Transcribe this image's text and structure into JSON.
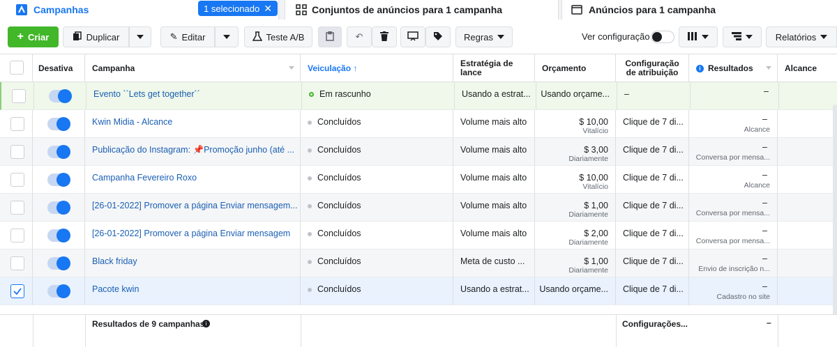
{
  "tabs": {
    "campaigns": "Campanhas",
    "selected_pill": "1 selecionado",
    "adsets": "Conjuntos de anúncios para 1 campanha",
    "ads": "Anúncios para 1 campanha"
  },
  "toolbar": {
    "create": "Criar",
    "duplicate": "Duplicar",
    "edit": "Editar",
    "ab_test": "Teste A/B",
    "rules": "Regras",
    "see_config": "Ver configuração",
    "reports": "Relatórios"
  },
  "columns": {
    "deactivate": "Desativa",
    "campaign": "Campanha",
    "delivery": "Veiculação ↑",
    "strategy_line1": "Estratégia de",
    "strategy_line2": "lance",
    "budget": "Orçamento",
    "attribution_line1": "Configuração",
    "attribution_line2": "de atribuição",
    "results": "Resultados",
    "reach": "Alcance"
  },
  "rows": [
    {
      "name": "Evento ``Lets get together´´",
      "delivery": "Em rascunho",
      "strategy": "Usando a estrat...",
      "budget": "Usando orçame...",
      "budget_sub": "",
      "attribution": "–",
      "result": "–",
      "result_sub": "",
      "checked": false
    },
    {
      "name": "Kwin Midia - Alcance",
      "delivery": "Concluídos",
      "strategy": "Volume mais alto",
      "budget": "$ 10,00",
      "budget_sub": "Vitalício",
      "attribution": "Clique de 7 di...",
      "result": "–",
      "result_sub": "Alcance",
      "checked": false
    },
    {
      "name": "Publicação do Instagram: 📌Promoção junho (até ...",
      "delivery": "Concluídos",
      "strategy": "Volume mais alto",
      "budget": "$ 3,00",
      "budget_sub": "Diariamente",
      "attribution": "Clique de 7 di...",
      "result": "–",
      "result_sub": "Conversa por mensa...",
      "checked": false
    },
    {
      "name": "Campanha Fevereiro Roxo",
      "delivery": "Concluídos",
      "strategy": "Volume mais alto",
      "budget": "$ 10,00",
      "budget_sub": "Vitalício",
      "attribution": "Clique de 7 di...",
      "result": "–",
      "result_sub": "Alcance",
      "checked": false
    },
    {
      "name": "[26-01-2022] Promover a página Enviar mensagem...",
      "delivery": "Concluídos",
      "strategy": "Volume mais alto",
      "budget": "$ 1,00",
      "budget_sub": "Diariamente",
      "attribution": "Clique de 7 di...",
      "result": "–",
      "result_sub": "Conversa por mensa...",
      "checked": false
    },
    {
      "name": "[26-01-2022] Promover a página Enviar mensagem",
      "delivery": "Concluídos",
      "strategy": "Volume mais alto",
      "budget": "$ 2,00",
      "budget_sub": "Diariamente",
      "attribution": "Clique de 7 di...",
      "result": "–",
      "result_sub": "Conversa por mensa...",
      "checked": false
    },
    {
      "name": "Black friday",
      "delivery": "Concluídos",
      "strategy": "Meta de custo ...",
      "budget": "$ 1,00",
      "budget_sub": "Diariamente",
      "attribution": "Clique de 7 di...",
      "result": "–",
      "result_sub": "Envio de inscrição n...",
      "checked": false
    },
    {
      "name": "Pacote kwin",
      "delivery": "Concluídos",
      "strategy": "Usando a estrat...",
      "budget": "Usando orçame...",
      "budget_sub": "",
      "attribution": "Clique de 7 di...",
      "result": "–",
      "result_sub": "Cadastro no site",
      "checked": true
    }
  ],
  "footer": {
    "summary": "Resultados de 9 campanhas",
    "configs": "Configurações...",
    "result": "–"
  },
  "colors": {
    "accent": "#1877f2",
    "create_green": "#42b72a",
    "draft_row": "#eff8ea",
    "selected_row": "#eaf2fe",
    "alt_row": "#f5f6f7"
  }
}
